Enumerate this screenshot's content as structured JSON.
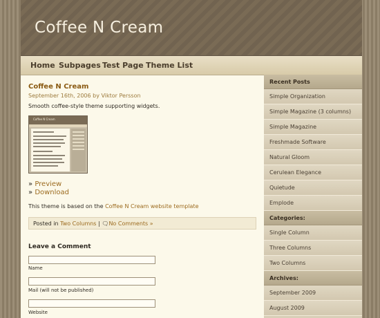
{
  "site": {
    "title": "Coffee N Cream"
  },
  "nav": [
    {
      "label": "Home"
    },
    {
      "label": "Subpages"
    },
    {
      "label": "Test Page"
    },
    {
      "label": "Theme List"
    }
  ],
  "post": {
    "title": "Coffee N Cream",
    "date": "September 16th, 2006",
    "by": "by",
    "author": "Viktor Persson",
    "description": "Smooth coffee-style theme supporting widgets.",
    "thumbnail_title": "Coffee N Cream",
    "preview_label": "Preview",
    "download_label": "Download",
    "link_prefix": "»",
    "based_text": "This theme is based on the",
    "based_link": "Coffee N Cream website template",
    "posted_in": "Posted in",
    "category": "Two Columns",
    "separator": "|",
    "comments": "No Comments »"
  },
  "comment_form": {
    "heading": "Leave a Comment",
    "name_label": "Name",
    "mail_label": "Mail (will not be published)",
    "website_label": "Website"
  },
  "sidebar": {
    "recent_heading": "Recent Posts",
    "recent": [
      "Simple Organization",
      "Simple Magazine (3 columns)",
      "Simple Magazine",
      "Freshmade Software",
      "Natural Gloom",
      "Cerulean Elegance",
      "Quietude",
      "Emplode"
    ],
    "categories_heading": "Categories:",
    "categories": [
      "Single Column",
      "Three Columns",
      "Two Columns"
    ],
    "archives_heading": "Archives:",
    "archives": [
      "September 2009",
      "August 2009"
    ]
  },
  "colors": {
    "accent": "#9c6b1f",
    "header_bg": "#7a6b55",
    "content_bg": "#fcf9ea"
  }
}
